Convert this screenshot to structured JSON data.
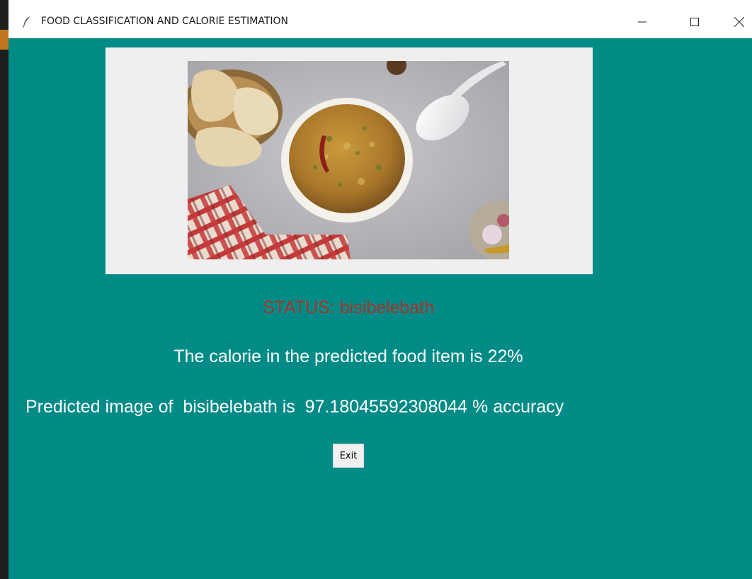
{
  "window": {
    "title": "FOOD CLASSIFICATION AND CALORIE ESTIMATION",
    "icon": "feather-icon",
    "controls": [
      "minimize-icon",
      "maximize-icon",
      "close-icon"
    ]
  },
  "main": {
    "status_text": "STATUS: bisibelebath",
    "calorie_text": "The calorie in the predicted food item is 22%",
    "accuracy_text": "Predicted image of  bisibelebath is  97.18045592308044 % accuracy",
    "exit_label": "Exit"
  },
  "colors": {
    "background": "#008b87",
    "status": "#a4352c",
    "text": "#ffffff",
    "image_frame": "#efeff0"
  }
}
